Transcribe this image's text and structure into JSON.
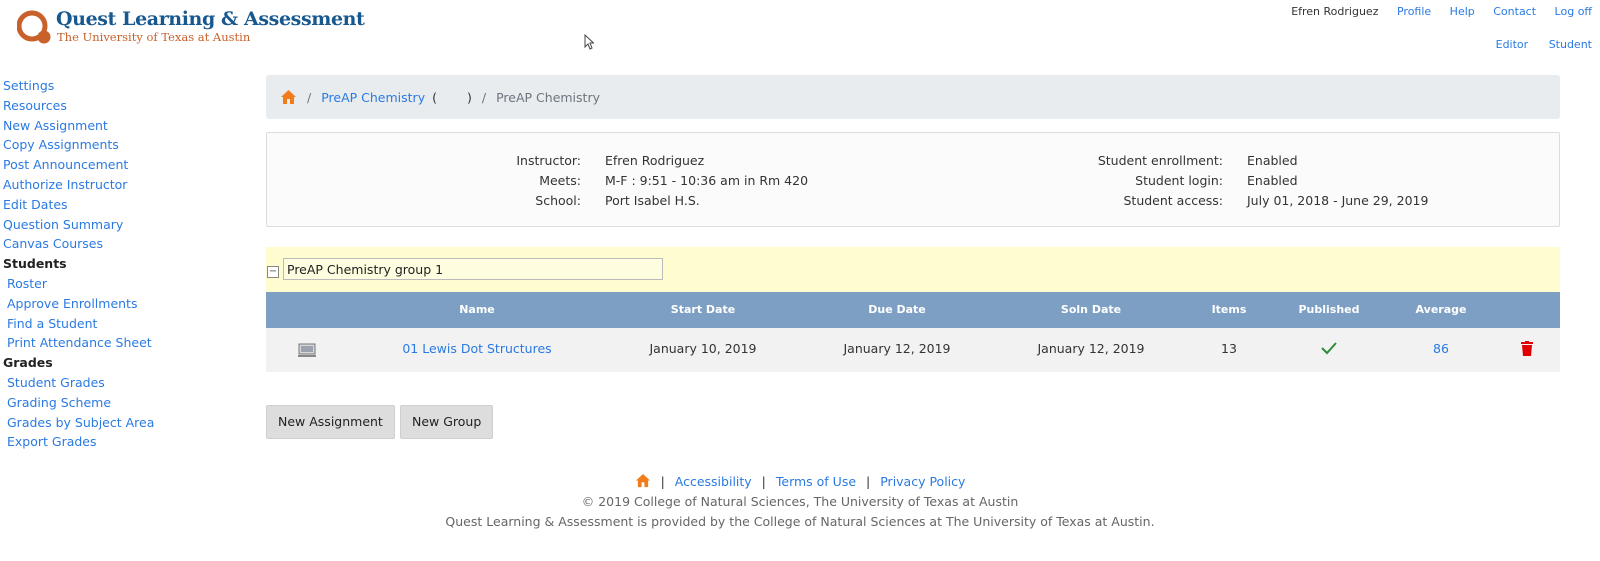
{
  "brand": {
    "title": "Quest Learning & Assessment",
    "subtitle": "The University of Texas at Austin",
    "colors": {
      "orange": "#c9612b",
      "blue": "#17588f"
    }
  },
  "topnav": {
    "user": "Efren Rodriguez",
    "links": [
      "Profile",
      "Help",
      "Contact",
      "Log off"
    ],
    "roles": [
      "Editor",
      "Student"
    ]
  },
  "sidebar": {
    "items": [
      {
        "label": "Settings",
        "type": "link"
      },
      {
        "label": "Resources",
        "type": "link"
      },
      {
        "label": "New Assignment",
        "type": "link"
      },
      {
        "label": "Copy Assignments",
        "type": "link"
      },
      {
        "label": "Post Announcement",
        "type": "link"
      },
      {
        "label": "Authorize Instructor",
        "type": "link"
      },
      {
        "label": "Edit Dates",
        "type": "link"
      },
      {
        "label": "Question Summary",
        "type": "link"
      },
      {
        "label": "Canvas Courses",
        "type": "link"
      },
      {
        "label": "Students",
        "type": "head"
      },
      {
        "label": "Roster",
        "type": "sub"
      },
      {
        "label": "Approve Enrollments",
        "type": "sub"
      },
      {
        "label": "Find a Student",
        "type": "sub"
      },
      {
        "label": "Print Attendance Sheet",
        "type": "sub"
      },
      {
        "label": "Grades",
        "type": "head"
      },
      {
        "label": "Student Grades",
        "type": "sub"
      },
      {
        "label": "Grading Scheme",
        "type": "sub"
      },
      {
        "label": "Grades by Subject Area",
        "type": "sub"
      },
      {
        "label": "Export Grades",
        "type": "sub"
      }
    ]
  },
  "breadcrumb": {
    "course_link": "PreAP Chemistry",
    "paren_open": "(",
    "paren_close": ")",
    "current": "PreAP Chemistry",
    "separator": "/"
  },
  "course_info": {
    "left": [
      {
        "label": "Instructor:",
        "value": "Efren Rodriguez"
      },
      {
        "label": "Meets:",
        "value": "M-F : 9:51 - 10:36 am in Rm 420"
      },
      {
        "label": "School:",
        "value": "Port Isabel H.S."
      }
    ],
    "right": [
      {
        "label": "Student enrollment:",
        "value": "Enabled"
      },
      {
        "label": "Student login:",
        "value": "Enabled"
      },
      {
        "label": "Student access:",
        "value": "July 01, 2018 - June 29, 2019"
      }
    ]
  },
  "group": {
    "collapse_symbol": "−",
    "name_value": "PreAP Chemistry group 1"
  },
  "table": {
    "headers": {
      "name": "Name",
      "start": "Start Date",
      "due": "Due Date",
      "soln": "Soln Date",
      "items": "Items",
      "published": "Published",
      "average": "Average"
    },
    "rows": [
      {
        "name": "01 Lewis Dot Structures",
        "start": "January 10, 2019",
        "due": "January 12, 2019",
        "soln": "January 12, 2019",
        "items": "13",
        "published": true,
        "average": "86"
      }
    ]
  },
  "buttons": {
    "new_assignment": "New Assignment",
    "new_group": "New Group"
  },
  "footer": {
    "links": [
      "Accessibility",
      "Terms of Use",
      "Privacy Policy"
    ],
    "copyright": "© 2019 College of Natural Sciences, The University of Texas at Austin",
    "provided_by": "Quest Learning & Assessment is provided by the College of Natural Sciences at The University of Texas at Austin."
  }
}
